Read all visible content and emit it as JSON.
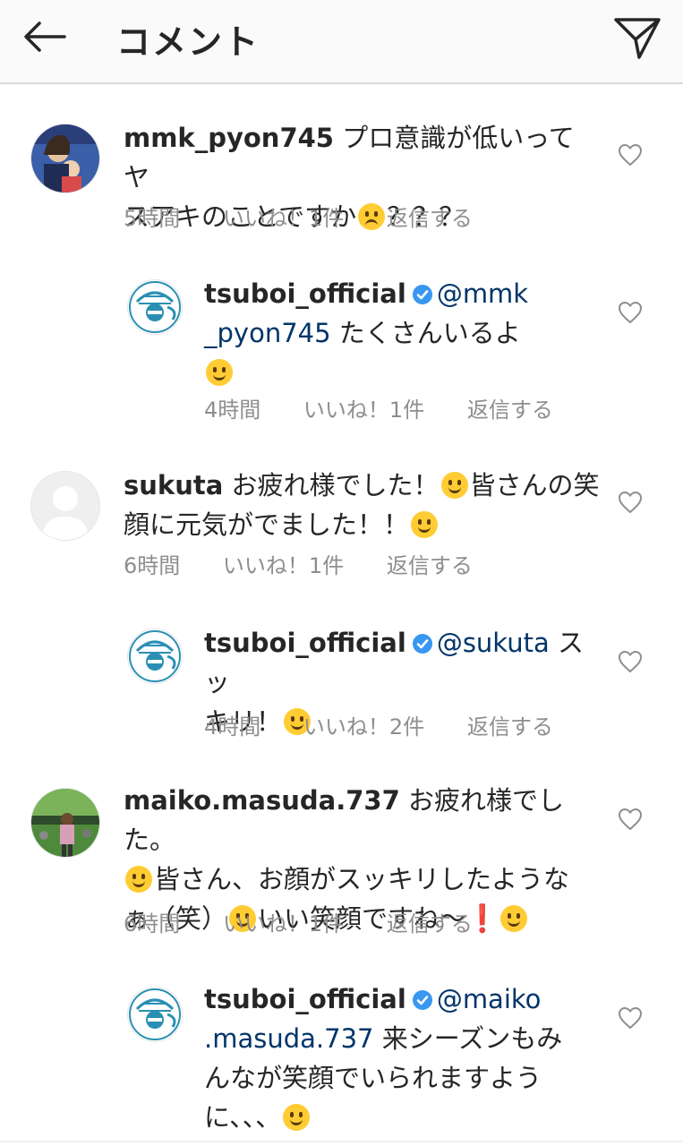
{
  "header": {
    "title": "コメント",
    "back_icon": "arrow-left-icon",
    "send_icon": "paper-plane-icon"
  },
  "comments": [
    {
      "username": "mmk_pyon745",
      "line1": "プロ意識が低いってヤ",
      "line2": "スアキのことですか",
      "line2_end": "？？？",
      "time": "5時間",
      "likes": "いいね！1件",
      "reply": "返信する"
    },
    {
      "username": "tsuboi_official",
      "mention1": "@mmk",
      "mention2": "_pyon745",
      "text": "たくさんいるよ",
      "time": "4時間",
      "likes": "いいね！1件",
      "reply": "返信する"
    },
    {
      "username": "sukuta",
      "line1a": "お疲れ様でした！",
      "line1b": "皆さんの笑",
      "line2": "顔に元気がでました！！",
      "time": "6時間",
      "likes": "いいね！1件",
      "reply": "返信する"
    },
    {
      "username": "tsuboi_official",
      "mention1": "@sukuta",
      "line1": "スッ",
      "line2": "キリ！",
      "time": "4時間",
      "likes": "いいね！2件",
      "reply": "返信する"
    },
    {
      "username": "maiko.masuda.737",
      "line1": "お疲れ様でした。",
      "line2": "皆さん、お顔がスッキリしたような",
      "line3a": "ぁ（笑）",
      "line3b": "いい笑顔ですね〜",
      "exclaim": "❗",
      "time": "6時間",
      "likes": "いいね！1件",
      "reply": "返信する"
    },
    {
      "username": "tsuboi_official",
      "mention1": "@maiko",
      "mention2": ".masuda.737",
      "line2": "来シーズンもみ",
      "line3": "んなが笑顔でいられますよう",
      "line4": "に、、、"
    }
  ],
  "colors": {
    "text": "#262626",
    "meta": "#8e8e8e",
    "mention": "#003569",
    "verified": "#3897f0"
  }
}
